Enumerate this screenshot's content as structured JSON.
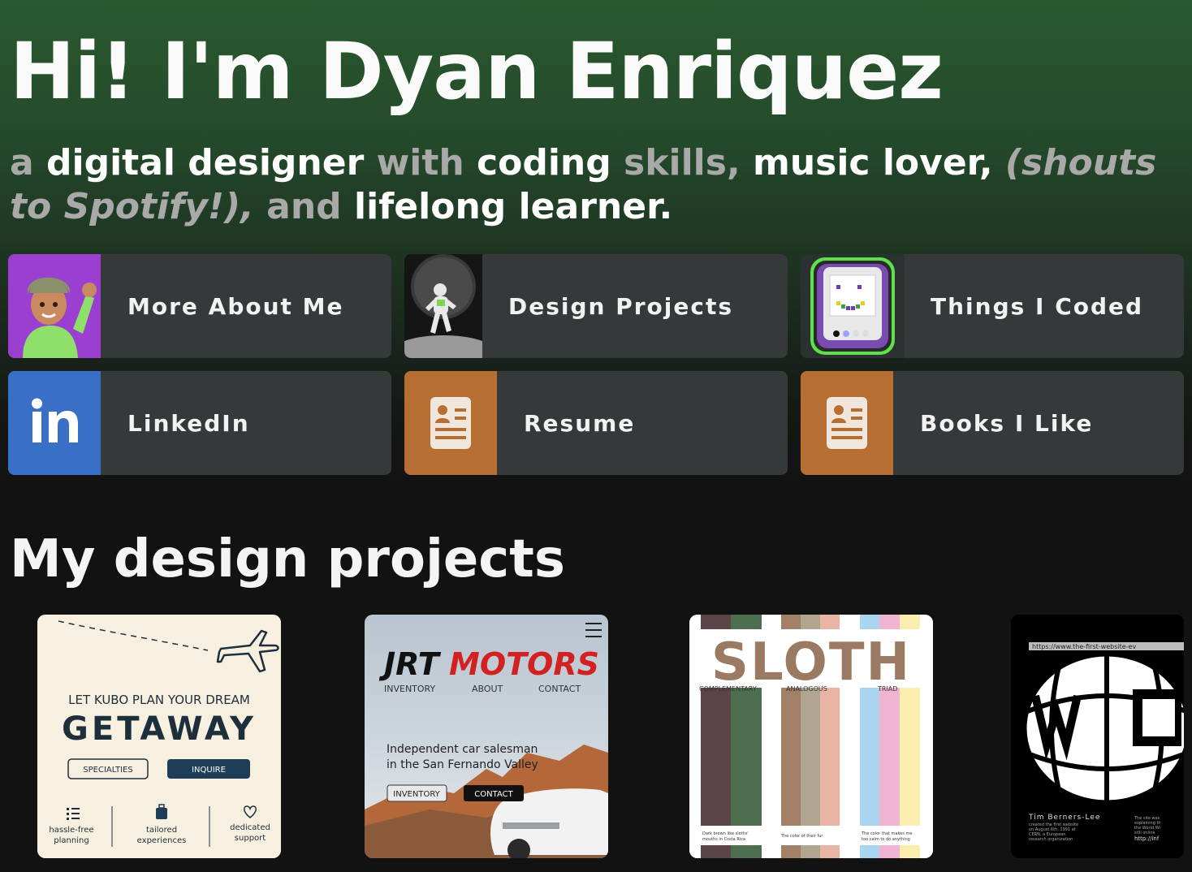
{
  "hero": {
    "title": "Hi! I'm Dyan Enriquez",
    "tagline": {
      "p1": "a ",
      "p2": "digital designer",
      "p3": " with ",
      "p4": "coding",
      "p5": " skills, ",
      "p6": "music lover,",
      "p7": " (shouts to Spotify!),",
      "p8": " and ",
      "p9": "lifelong learner."
    }
  },
  "links": [
    {
      "label": "More About Me",
      "icon": "memoji-wave-icon"
    },
    {
      "label": "Design Projects",
      "icon": "astronaut-moon-icon"
    },
    {
      "label": "Things I Coded",
      "icon": "etch-a-sketch-icon"
    },
    {
      "label": "LinkedIn",
      "icon": "linkedin-icon"
    },
    {
      "label": "Resume",
      "icon": "resume-document-icon"
    },
    {
      "label": "Books I Like",
      "icon": "resume-document-icon"
    }
  ],
  "section": {
    "title": "My design projects"
  },
  "projects": {
    "kubo": {
      "line1": "LET KUBO PLAN YOUR DREAM",
      "line2": "GETAWAY",
      "btn1": "SPECIALTIES",
      "btn2": "INQUIRE",
      "f1a": "hassle-free",
      "f1b": "planning",
      "f2a": "tailored",
      "f2b": "experiences",
      "f3a": "dedicated",
      "f3b": "support"
    },
    "jrt": {
      "logo1": "JRT",
      "logo2": "MOTORS",
      "nav1": "INVENTORY",
      "nav2": "ABOUT",
      "nav3": "CONTACT",
      "tag1": "Independent car salesman",
      "tag2": "in the San Fernando Valley",
      "btn1": "INVENTORY",
      "btn2": "CONTACT"
    },
    "sloth": {
      "title": "SLOTH",
      "c1": "COMPLEMENTARY",
      "c2": "ANALOGOUS",
      "c3": "TRIAD",
      "n1a": "Dark brown like sloths'",
      "n1b": "mouths in Costa Rica",
      "n2a": "The color of their fur",
      "n3a": "The color that makes me",
      "n3b": "too calm to do anything"
    },
    "www": {
      "url": "https://www.the-first-website-ev",
      "name": "Tim Berners-Lee",
      "bio1": "created the first website",
      "bio2": "on August 6th, 1991 at",
      "bio3": "CERN, a European",
      "bio4": "research organization",
      "side1": "The site was",
      "side2": "explaining th",
      "side3": "the World Wi",
      "side4": "still online",
      "link": "http://inf"
    }
  },
  "colors": {
    "card_bg": "#35393a",
    "purple": "#9b3fd0",
    "linkedin_blue": "#3a6fc8",
    "resume_orange": "#b66e33",
    "etch_green": "#5de04a",
    "sloth_brown": "#9b7a63"
  }
}
